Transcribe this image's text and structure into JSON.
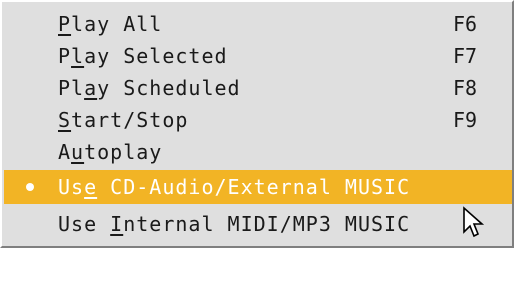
{
  "menu": {
    "items": [
      {
        "pre": "",
        "acc": "P",
        "post": "lay All",
        "shortcut": "F6"
      },
      {
        "pre": "P",
        "acc": "l",
        "post": "ay Selected",
        "shortcut": "F7"
      },
      {
        "pre": "Pl",
        "acc": "a",
        "post": "y Scheduled",
        "shortcut": "F8"
      },
      {
        "pre": "",
        "acc": "S",
        "post": "tart/Stop",
        "shortcut": "F9"
      },
      {
        "pre": "A",
        "acc": "u",
        "post": "toplay",
        "shortcut": ""
      },
      {
        "pre": "Us",
        "acc": "e",
        "post": " CD-Audio/External MUSIC",
        "shortcut": "",
        "checked": true,
        "highlighted": true
      },
      {
        "pre": "Use ",
        "acc": "I",
        "post": "nternal MIDI/MP3 MUSIC",
        "shortcut": ""
      }
    ]
  },
  "colors": {
    "highlight": "#f2b425",
    "menu_bg": "#dfdfdf"
  },
  "cursor_icon": "arrow-pointer-icon"
}
